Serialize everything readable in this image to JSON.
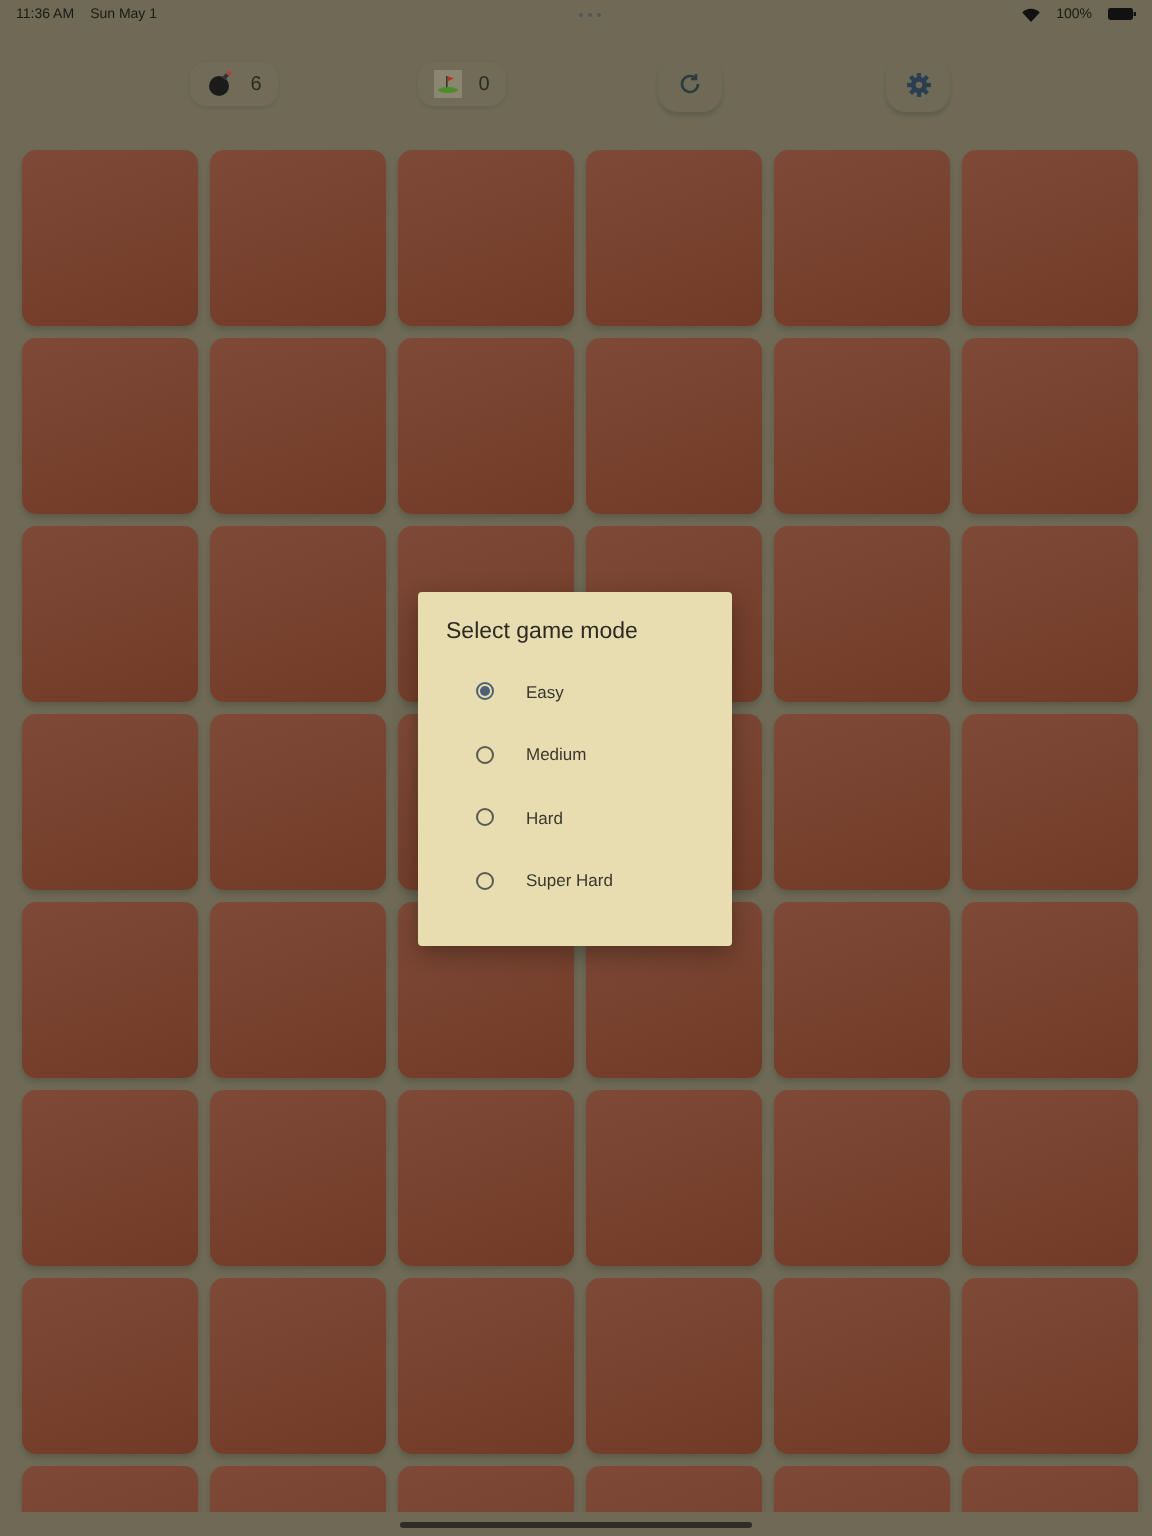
{
  "status_bar": {
    "time": "11:36 AM",
    "date": "Sun May 1",
    "battery": "100%"
  },
  "toolbar": {
    "mines": "6",
    "flags": "0"
  },
  "dialog": {
    "title": "Select game mode",
    "options": [
      {
        "label": "Easy",
        "selected": true
      },
      {
        "label": "Medium",
        "selected": false
      },
      {
        "label": "Hard",
        "selected": false
      },
      {
        "label": "Super Hard",
        "selected": false
      }
    ]
  }
}
